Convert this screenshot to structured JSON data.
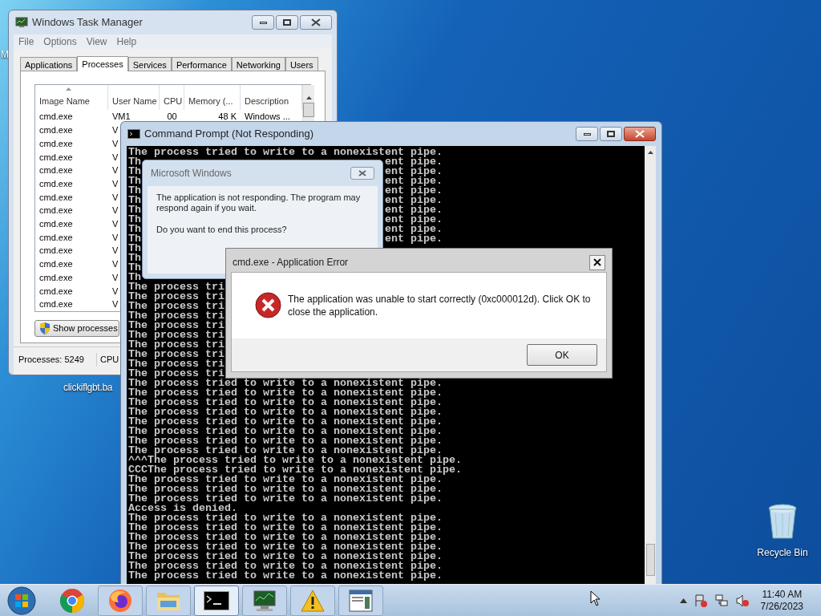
{
  "desktop_icons": [
    {
      "label": "M"
    },
    {
      "label": "clickiflgbt.ba"
    },
    {
      "label": "Recycle Bin"
    }
  ],
  "task_manager": {
    "title": "Windows Task Manager",
    "menu": [
      "File",
      "Options",
      "View",
      "Help"
    ],
    "tabs": [
      {
        "label": "Applications",
        "selected": false
      },
      {
        "label": "Processes",
        "selected": true
      },
      {
        "label": "Services",
        "selected": false
      },
      {
        "label": "Performance",
        "selected": false
      },
      {
        "label": "Networking",
        "selected": false
      },
      {
        "label": "Users",
        "selected": false
      }
    ],
    "columns": [
      "Image Name",
      "User Name",
      "CPU",
      "Memory (...",
      "Description"
    ],
    "rows": [
      [
        "cmd.exe",
        "VM1",
        "00",
        "48 K",
        "Windows ..."
      ],
      [
        "cmd.exe",
        "V"
      ],
      [
        "cmd.exe",
        "V"
      ],
      [
        "cmd.exe",
        "V"
      ],
      [
        "cmd.exe",
        "V"
      ],
      [
        "cmd.exe",
        "V"
      ],
      [
        "cmd.exe",
        "V"
      ],
      [
        "cmd.exe",
        "V"
      ],
      [
        "cmd.exe",
        "V"
      ],
      [
        "cmd.exe",
        "V"
      ],
      [
        "cmd.exe",
        "V"
      ],
      [
        "cmd.exe",
        "V"
      ],
      [
        "cmd.exe",
        "V"
      ],
      [
        "cmd.exe",
        "V"
      ],
      [
        "cmd.exe",
        "V"
      ]
    ],
    "show_button": "Show processes",
    "status": [
      "Processes: 5249",
      "CPU"
    ]
  },
  "command_prompt": {
    "title": "Command Prompt (Not Responding)",
    "lines": [
      {
        "text": "The process tried to write to a nonexistent pipe."
      },
      {
        "left": "Th",
        "right": "ent pipe."
      },
      {
        "left": "Th",
        "right": "ent pipe."
      },
      {
        "left": "Th",
        "right": "ent pipe."
      },
      {
        "left": "Th",
        "right": "ent pipe."
      },
      {
        "left": "Th",
        "right": "ent pipe."
      },
      {
        "left": "Th",
        "right": "ent pipe."
      },
      {
        "left": "Th",
        "right": "ent pipe."
      },
      {
        "left": "Th",
        "right": "ent pipe."
      },
      {
        "left": "Th",
        "right": "ent pipe."
      },
      {
        "left": "Th"
      },
      {
        "left": "Th"
      },
      {
        "left": "Th"
      },
      {
        "left": "Th"
      },
      {
        "left": "The process tri"
      },
      {
        "left": "The process tri"
      },
      {
        "left": "The process tri"
      },
      {
        "left": "The process tri"
      },
      {
        "left": "The process tri"
      },
      {
        "left": "The process tri"
      },
      {
        "left": "The process tri"
      },
      {
        "left": "The process tri"
      },
      {
        "left": "The process tri"
      },
      {
        "left": "The process tri"
      },
      {
        "text": "The process tried to write to a nonexistent pipe."
      },
      {
        "text": "The process tried to write to a nonexistent pipe."
      },
      {
        "text": "The process tried to write to a nonexistent pipe."
      },
      {
        "text": "The process tried to write to a nonexistent pipe."
      },
      {
        "text": "The process tried to write to a nonexistent pipe."
      },
      {
        "text": "The process tried to write to a nonexistent pipe."
      },
      {
        "text": "The process tried to write to a nonexistent pipe."
      },
      {
        "text": "The process tried to write to a nonexistent pipe."
      },
      {
        "text": "^^^The process tried to write to a nonexistent pipe."
      },
      {
        "text": "CCCThe process tried to write to a nonexistent pipe."
      },
      {
        "text": "The process tried to write to a nonexistent pipe."
      },
      {
        "text": "The process tried to write to a nonexistent pipe."
      },
      {
        "text": "The process tried to write to a nonexistent pipe."
      },
      {
        "text": "Access is denied."
      },
      {
        "text": "The process tried to write to a nonexistent pipe."
      },
      {
        "text": "The process tried to write to a nonexistent pipe."
      },
      {
        "text": "The process tried to write to a nonexistent pipe."
      },
      {
        "text": "The process tried to write to a nonexistent pipe."
      },
      {
        "text": "The process tried to write to a nonexistent pipe."
      },
      {
        "text": "The process tried to write to a nonexistent pipe."
      },
      {
        "text": "The process tried to write to a nonexistent pipe."
      }
    ]
  },
  "not_responding_dialog": {
    "title": "Microsoft Windows",
    "message": "The application is not responding. The program may respond again if you wait.",
    "question": "Do you want to end this process?"
  },
  "error_dialog": {
    "title": "cmd.exe - Application Error",
    "message": "The application was unable to start correctly (0xc000012d). Click OK to close the application.",
    "button": "OK"
  },
  "taskbar": {
    "apps": [
      {
        "kind": "chrome",
        "active": false
      },
      {
        "kind": "firefox",
        "active": false
      },
      {
        "kind": "explorer",
        "active": false
      },
      {
        "kind": "console",
        "active": true
      },
      {
        "kind": "monitor",
        "active": false
      },
      {
        "kind": "warning",
        "active": false
      },
      {
        "kind": "window",
        "active": false
      }
    ],
    "time": "11:40 AM",
    "date": "7/26/2023"
  }
}
